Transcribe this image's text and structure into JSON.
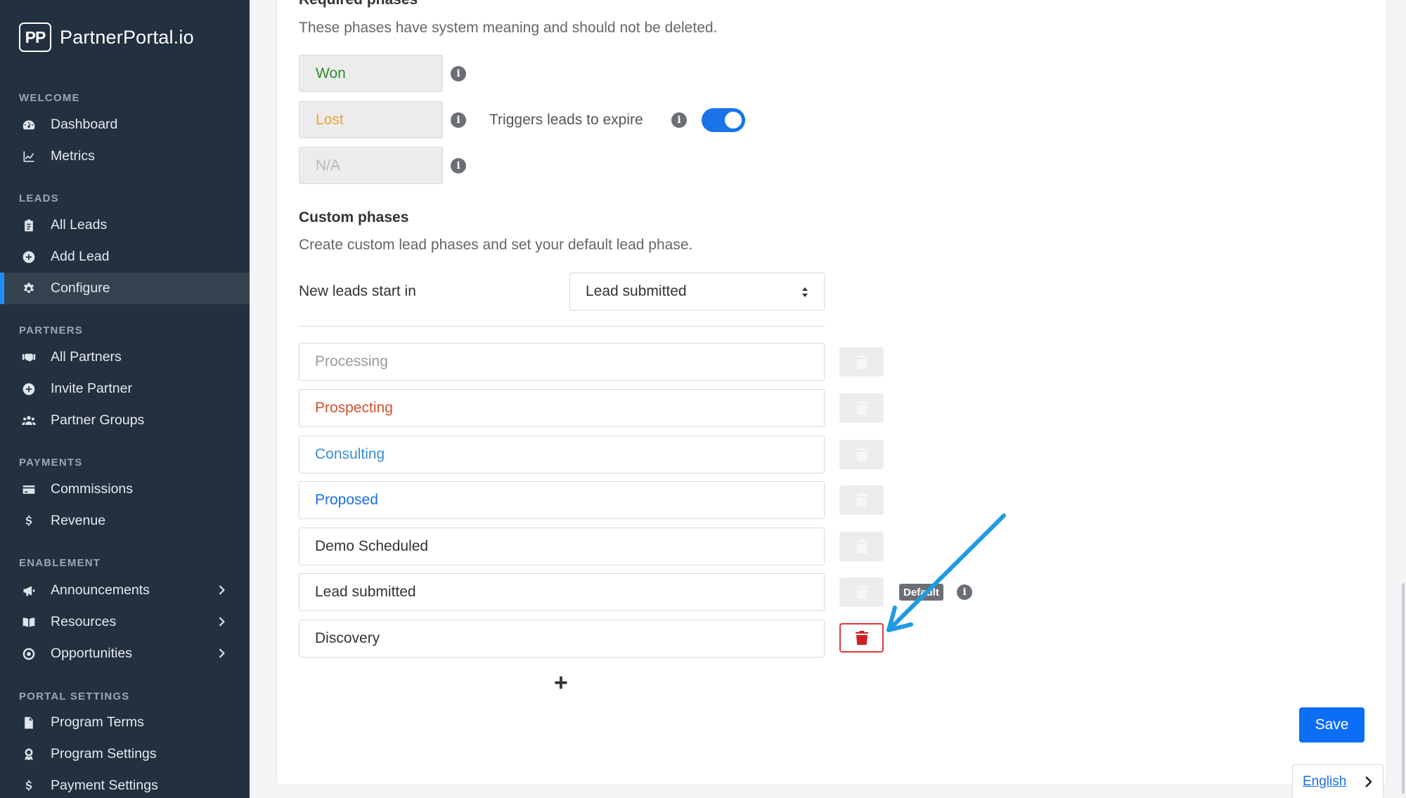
{
  "brand": {
    "logo": "PP",
    "name": "PartnerPortal.io"
  },
  "sidebar": {
    "sections": [
      {
        "title": "WELCOME",
        "items": [
          {
            "label": "Dashboard",
            "icon": "dashboard-icon"
          },
          {
            "label": "Metrics",
            "icon": "chart-icon"
          }
        ]
      },
      {
        "title": "LEADS",
        "items": [
          {
            "label": "All Leads",
            "icon": "clipboard-icon"
          },
          {
            "label": "Add Lead",
            "icon": "plus-circle-icon"
          },
          {
            "label": "Configure",
            "icon": "gear-icon",
            "active": true
          }
        ]
      },
      {
        "title": "PARTNERS",
        "items": [
          {
            "label": "All Partners",
            "icon": "handshake-icon"
          },
          {
            "label": "Invite Partner",
            "icon": "plus-circle-icon"
          },
          {
            "label": "Partner Groups",
            "icon": "users-icon"
          }
        ]
      },
      {
        "title": "PAYMENTS",
        "items": [
          {
            "label": "Commissions",
            "icon": "credit-card-icon"
          },
          {
            "label": "Revenue",
            "icon": "dollar-icon"
          }
        ]
      },
      {
        "title": "ENABLEMENT",
        "items": [
          {
            "label": "Announcements",
            "icon": "megaphone-icon",
            "chevron": true
          },
          {
            "label": "Resources",
            "icon": "book-icon",
            "chevron": true
          },
          {
            "label": "Opportunities",
            "icon": "target-icon",
            "chevron": true
          }
        ]
      },
      {
        "title": "PORTAL SETTINGS",
        "items": [
          {
            "label": "Program Terms",
            "icon": "file-icon"
          },
          {
            "label": "Program Settings",
            "icon": "award-icon"
          },
          {
            "label": "Payment Settings",
            "icon": "dollar-icon"
          }
        ]
      }
    ]
  },
  "required": {
    "title": "Required phases",
    "description": "These phases have system meaning and should not be deleted.",
    "phases": [
      {
        "label": "Won",
        "color": "#2e8b2e"
      },
      {
        "label": "Lost",
        "color": "#f0a13a"
      },
      {
        "label": "N/A",
        "color": "#b5b8bc"
      }
    ],
    "expire_label": "Triggers leads to expire",
    "expire_enabled": true
  },
  "custom": {
    "title": "Custom phases",
    "description": "Create custom lead phases and set your default lead phase.",
    "start_label": "New leads start in",
    "start_value": "Lead submitted",
    "phases": [
      {
        "label": "Processing",
        "color": "#9a9a9a"
      },
      {
        "label": "Prospecting",
        "color": "#d2522f"
      },
      {
        "label": "Consulting",
        "color": "#3d8fd1"
      },
      {
        "label": "Proposed",
        "color": "#1a6fe0"
      },
      {
        "label": "Demo Scheduled",
        "color": "#333333"
      },
      {
        "label": "Lead submitted",
        "color": "#333333",
        "default": true
      },
      {
        "label": "Discovery",
        "color": "#333333",
        "deletable": true
      }
    ],
    "default_badge": "Default",
    "add_glyph": "+"
  },
  "actions": {
    "save_label": "Save"
  },
  "language": {
    "label": "English"
  },
  "colors": {
    "accent": "#0b6ef5",
    "sidebar_bg": "#22303f",
    "danger": "#cf1f26",
    "annotation": "#1e9be3"
  }
}
